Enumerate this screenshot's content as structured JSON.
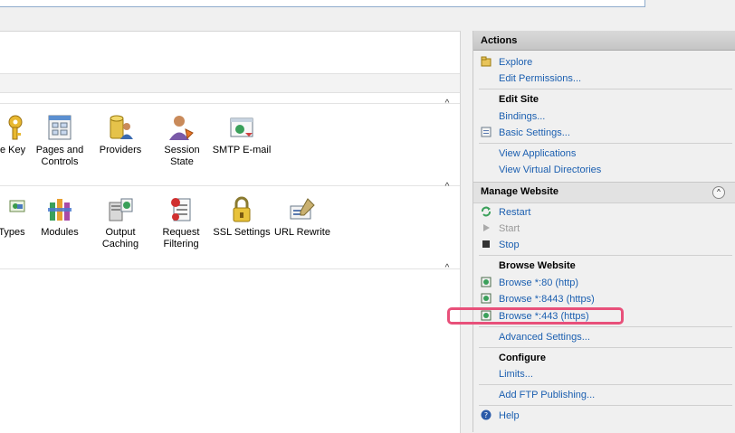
{
  "features": {
    "row1": [
      {
        "label": "ne Key",
        "icon": "machine-key-icon"
      },
      {
        "label": "Pages and\nControls",
        "icon": "pages-controls-icon"
      },
      {
        "label": "Providers",
        "icon": "providers-icon"
      },
      {
        "label": "Session State",
        "icon": "session-state-icon"
      },
      {
        "label": "SMTP E-mail",
        "icon": "smtp-email-icon"
      }
    ],
    "row2": [
      {
        "label": "Types",
        "icon": "mime-types-icon"
      },
      {
        "label": "Modules",
        "icon": "modules-icon"
      },
      {
        "label": "Output\nCaching",
        "icon": "output-caching-icon"
      },
      {
        "label": "Request\nFiltering",
        "icon": "request-filtering-icon"
      },
      {
        "label": "SSL Settings",
        "icon": "ssl-settings-icon"
      },
      {
        "label": "URL Rewrite",
        "icon": "url-rewrite-icon"
      }
    ],
    "collapse_glyph": "^"
  },
  "actions": {
    "title": "Actions",
    "explore": "Explore",
    "edit_permissions": "Edit Permissions...",
    "edit_site": "Edit Site",
    "bindings": "Bindings...",
    "basic_settings": "Basic Settings...",
    "view_applications": "View Applications",
    "view_virtual_directories": "View Virtual Directories",
    "manage_website": "Manage Website",
    "manage_collapse": "^",
    "restart": "Restart",
    "start": "Start",
    "stop": "Stop",
    "browse_website": "Browse Website",
    "browse_80": "Browse *:80 (http)",
    "browse_8443": "Browse *:8443 (https)",
    "browse_443": "Browse *:443 (https)",
    "advanced_settings": "Advanced Settings...",
    "configure": "Configure",
    "limits": "Limits...",
    "add_ftp": "Add FTP Publishing...",
    "help": "Help"
  },
  "colors": {
    "link": "#1b5fb0",
    "highlight": "#e8507a"
  }
}
